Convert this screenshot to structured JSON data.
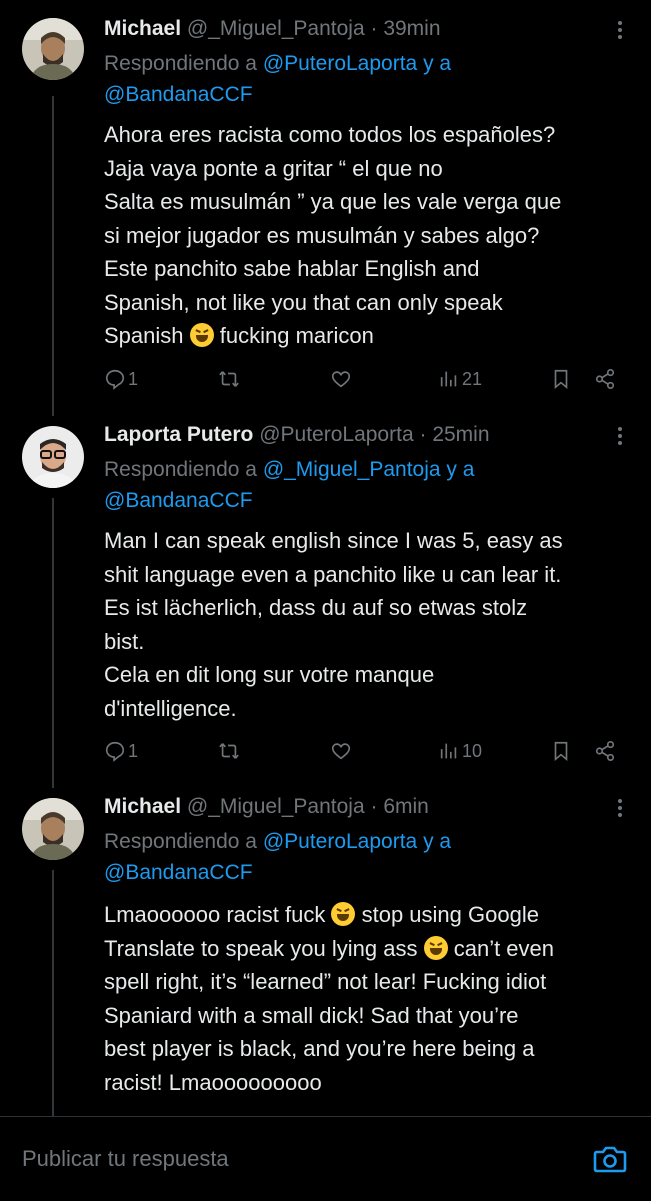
{
  "tweets": [
    {
      "name": "Michael",
      "handle": "@_Miguel_Pantoja",
      "separator": "·",
      "time": "39min",
      "reply_prefix": "Respondiendo a",
      "reply_user1": "@PuteroLaporta",
      "reply_conj": "y a",
      "reply_user2": "@BandanaCCF",
      "body_lines": [
        "Ahora eres racista como todos los españoles?",
        "Jaja vaya ponte a gritar “ el que no",
        "Salta es musulmán ” ya que les vale verga que",
        "si mejor jugador es musulmán y sabes algo?",
        "Este panchito sabe hablar English and",
        "Spanish, not like you that can only speak"
      ],
      "body_last_pre": "Spanish",
      "body_last_post": "fucking maricon",
      "replies": "1",
      "views": "21"
    },
    {
      "name": "Laporta Putero",
      "handle": "@PuteroLaporta",
      "separator": "·",
      "time": "25min",
      "reply_prefix": "Respondiendo a",
      "reply_user1": "@_Miguel_Pantoja",
      "reply_conj": "y a",
      "reply_user2": "@BandanaCCF",
      "body_lines": [
        "Man I can speak english since I was 5, easy as",
        "shit language even a panchito like u can lear it.",
        "Es ist lächerlich, dass du auf so etwas stolz",
        "bist.",
        "Cela en dit long sur votre manque",
        "d'intelligence."
      ],
      "replies": "1",
      "views": "10"
    },
    {
      "name": "Michael",
      "handle": "@_Miguel_Pantoja",
      "separator": "·",
      "time": "6min",
      "reply_prefix": "Respondiendo a",
      "reply_user1": "@PuteroLaporta",
      "reply_conj": "y a",
      "reply_user2": "@BandanaCCF",
      "line1_pre": "Lmaoooooo racist fuck",
      "line1_post": "stop using Google",
      "line2_pre": "Translate to speak you lying ass",
      "line2_post": "can’t even",
      "body_lines": [
        "spell right, it’s “learned” not lear! Fucking idiot",
        "Spaniard with a small dick! Sad that you’re",
        "best player is black, and you’re here being a",
        "racist! Lmaooooooooo"
      ]
    }
  ],
  "reply_bar": {
    "placeholder": "Publicar tu respuesta"
  },
  "colors": {
    "background": "#000000",
    "text": "#e7e9ea",
    "muted": "#71767b",
    "link": "#1d9bf0"
  }
}
